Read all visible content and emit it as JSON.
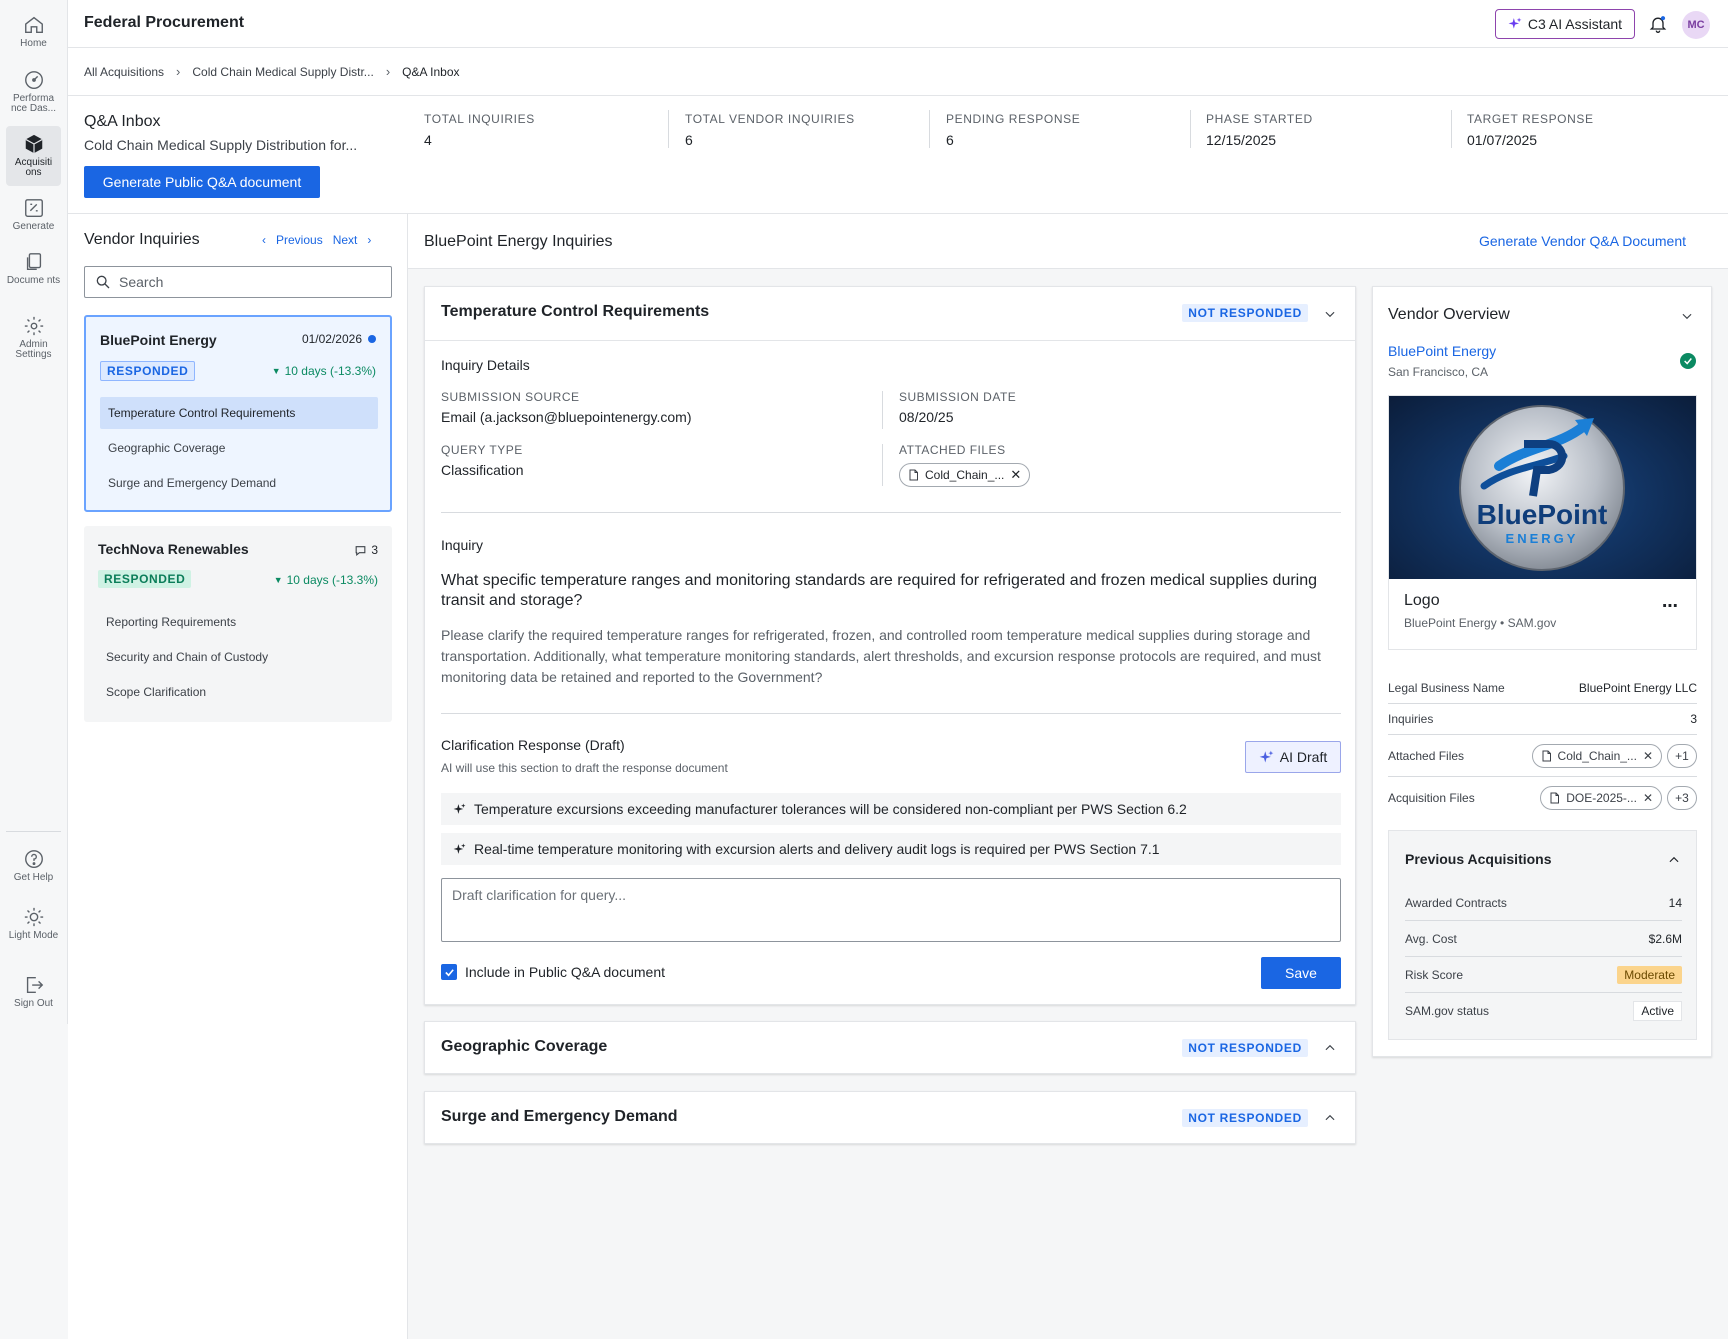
{
  "app": {
    "title": "Federal Procurement",
    "assistant_label": "C3 AI Assistant",
    "avatar_initials": "MC"
  },
  "nav": {
    "items": [
      {
        "id": "home",
        "label": "Home",
        "icon": "home-icon"
      },
      {
        "id": "performance",
        "label": "Performa nce Das...",
        "icon": "gauge-icon"
      },
      {
        "id": "acquisitions",
        "label": "Acquisiti ons",
        "icon": "box-icon",
        "active": true
      },
      {
        "id": "generate",
        "label": "Generate",
        "icon": "generate-icon"
      },
      {
        "id": "documents",
        "label": "Docume nts",
        "icon": "documents-icon"
      },
      {
        "id": "admin",
        "label": "Admin Settings",
        "icon": "gear-icon"
      }
    ],
    "bottom": [
      {
        "id": "help",
        "label": "Get Help",
        "icon": "help-icon"
      },
      {
        "id": "light",
        "label": "Light Mode",
        "icon": "sun-icon"
      },
      {
        "id": "signout",
        "label": "Sign Out",
        "icon": "sign-out-icon"
      }
    ]
  },
  "breadcrumb": [
    "All Acquisitions",
    "Cold Chain Medical Supply Distr...",
    "Q&A Inbox"
  ],
  "summary": {
    "title": "Q&A Inbox",
    "subtitle": "Cold Chain Medical Supply Distribution for...",
    "generate_label": "Generate Public Q&A document",
    "stats": [
      {
        "label": "TOTAL INQUIRIES",
        "value": "4"
      },
      {
        "label": "TOTAL VENDOR INQUIRIES",
        "value": "6"
      },
      {
        "label": "PENDING RESPONSE",
        "value": "6"
      },
      {
        "label": "PHASE STARTED",
        "value": "12/15/2025"
      },
      {
        "label": "TARGET RESPONSE",
        "value": "01/07/2025"
      }
    ]
  },
  "vendor_inquiries": {
    "title": "Vendor Inquiries",
    "prev_label": "Previous",
    "next_label": "Next",
    "search_placeholder": "Search",
    "vendors": [
      {
        "name": "BluePoint Energy",
        "date": "01/02/2026",
        "status": "RESPONDED",
        "trend": "10 days (-13.3%)",
        "items": [
          "Temperature Control Requirements",
          "Geographic Coverage",
          "Surge and Emergency Demand"
        ]
      },
      {
        "name": "TechNova Renewables",
        "comments": "3",
        "status": "RESPONDED",
        "trend": "10 days (-13.3%)",
        "items": [
          "Reporting Requirements",
          "Security and Chain of Custody",
          "Scope Clarification"
        ]
      }
    ]
  },
  "main": {
    "title": "BluePoint Energy Inquiries",
    "generate_vendor_label": "Generate Vendor Q&A Document",
    "inquiries": [
      {
        "title": "Temperature Control Requirements",
        "status": "NOT RESPONDED",
        "details_label": "Inquiry Details",
        "submission_source_label": "SUBMISSION SOURCE",
        "submission_source": "Email (a.jackson@bluepointenergy.com)",
        "submission_date_label": "SUBMISSION DATE",
        "submission_date": "08/20/25",
        "query_type_label": "QUERY TYPE",
        "query_type": "Classification",
        "attached_files_label": "ATTACHED FILES",
        "attached_file": "Cold_Chain_...",
        "inquiry_label": "Inquiry",
        "question": "What specific temperature ranges and monitoring standards are required for refrigerated and frozen medical supplies during transit and storage?",
        "question_detail": "Please clarify the required temperature ranges for refrigerated, frozen, and controlled room temperature medical supplies during storage and transportation. Additionally, what temperature monitoring standards, alert thresholds, and excursion response protocols are required, and must monitoring data be retained and reported to the Government?",
        "draft_label": "Clarification Response (Draft)",
        "draft_sub": "AI will use this section to draft the response document",
        "ai_draft_label": "AI Draft",
        "suggestions": [
          "Temperature excursions exceeding manufacturer tolerances will be considered non-compliant per PWS Section 6.2",
          "Real-time temperature monitoring with excursion alerts and delivery audit logs is required per PWS Section 7.1"
        ],
        "draft_placeholder": "Draft clarification for query...",
        "include_label": "Include in Public Q&A document",
        "save_label": "Save"
      },
      {
        "title": "Geographic Coverage",
        "status": "NOT RESPONDED"
      },
      {
        "title": "Surge and Emergency Demand",
        "status": "NOT RESPONDED"
      }
    ]
  },
  "vendor_overview": {
    "title": "Vendor Overview",
    "name": "BluePoint Energy",
    "location": "San Francisco, CA",
    "logo_caption": "Logo",
    "logo_source": "BluePoint Energy • SAM.gov",
    "logo_text_main": "BluePoint",
    "logo_text_sub": "ENERGY",
    "legal_name_label": "Legal Business Name",
    "legal_name": "BluePoint Energy LLC",
    "inquiries_label": "Inquiries",
    "inquiries": "3",
    "attached_files_label": "Attached Files",
    "attached_file": "Cold_Chain_...",
    "attached_more": "+1",
    "acq_files_label": "Acquisition Files",
    "acq_file": "DOE-2025-...",
    "acq_more": "+3",
    "previous": {
      "title": "Previous Acquisitions",
      "awarded_label": "Awarded Contracts",
      "awarded": "14",
      "avg_cost_label": "Avg. Cost",
      "avg_cost": "$2.6M",
      "risk_label": "Risk Score",
      "risk": "Moderate",
      "sam_label": "SAM.gov status",
      "sam": "Active"
    }
  },
  "colors": {
    "accent": "#1a66e3",
    "success": "#0b8a62",
    "warning": "#fbd48c",
    "assistant": "#8e44ad"
  }
}
